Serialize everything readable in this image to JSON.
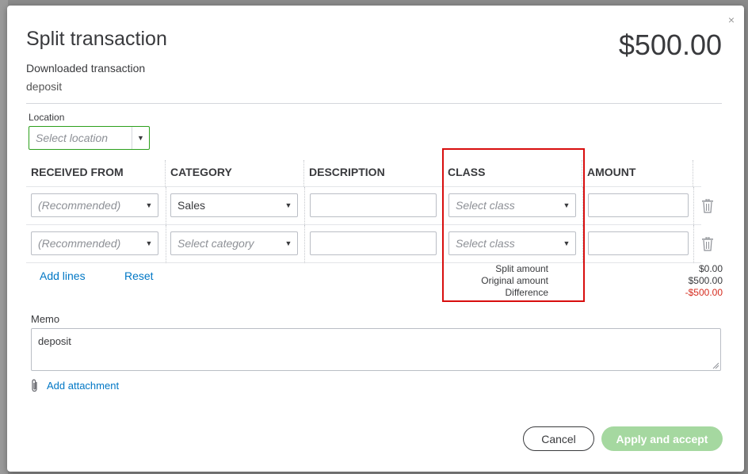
{
  "modal": {
    "title": "Split transaction",
    "total": "$500.00",
    "close_glyph": "×"
  },
  "downloaded": {
    "label": "Downloaded transaction",
    "value": "deposit"
  },
  "location": {
    "label": "Location",
    "placeholder": "Select location"
  },
  "table": {
    "headers": [
      "RECEIVED FROM",
      "CATEGORY",
      "DESCRIPTION",
      "CLASS",
      "AMOUNT"
    ],
    "rows": [
      {
        "received_from_placeholder": "(Recommended)",
        "category_value": "Sales",
        "category_placeholder": "",
        "description": "",
        "class_placeholder": "Select class",
        "amount": ""
      },
      {
        "received_from_placeholder": "(Recommended)",
        "category_value": "",
        "category_placeholder": "Select category",
        "description": "",
        "class_placeholder": "Select class",
        "amount": ""
      }
    ]
  },
  "actions": {
    "add_lines": "Add lines",
    "reset": "Reset"
  },
  "summary": {
    "split_amount_label": "Split amount",
    "original_amount_label": "Original amount",
    "difference_label": "Difference",
    "split_amount": "$0.00",
    "original_amount": "$500.00",
    "difference": "-$500.00"
  },
  "memo": {
    "label": "Memo",
    "value": "deposit"
  },
  "attachment": {
    "label": "Add attachment"
  },
  "footer": {
    "cancel": "Cancel",
    "apply": "Apply and accept"
  },
  "colors": {
    "accent_green": "#2ca01c",
    "disabled_green": "#a5d8a0",
    "link_blue": "#0077c5",
    "negative_red": "#d52b1e",
    "highlight_red": "#d80e0e"
  },
  "icons": {
    "close": "close-icon",
    "caret": "chevron-down-icon",
    "trash": "trash-icon",
    "clip": "paperclip-icon"
  }
}
